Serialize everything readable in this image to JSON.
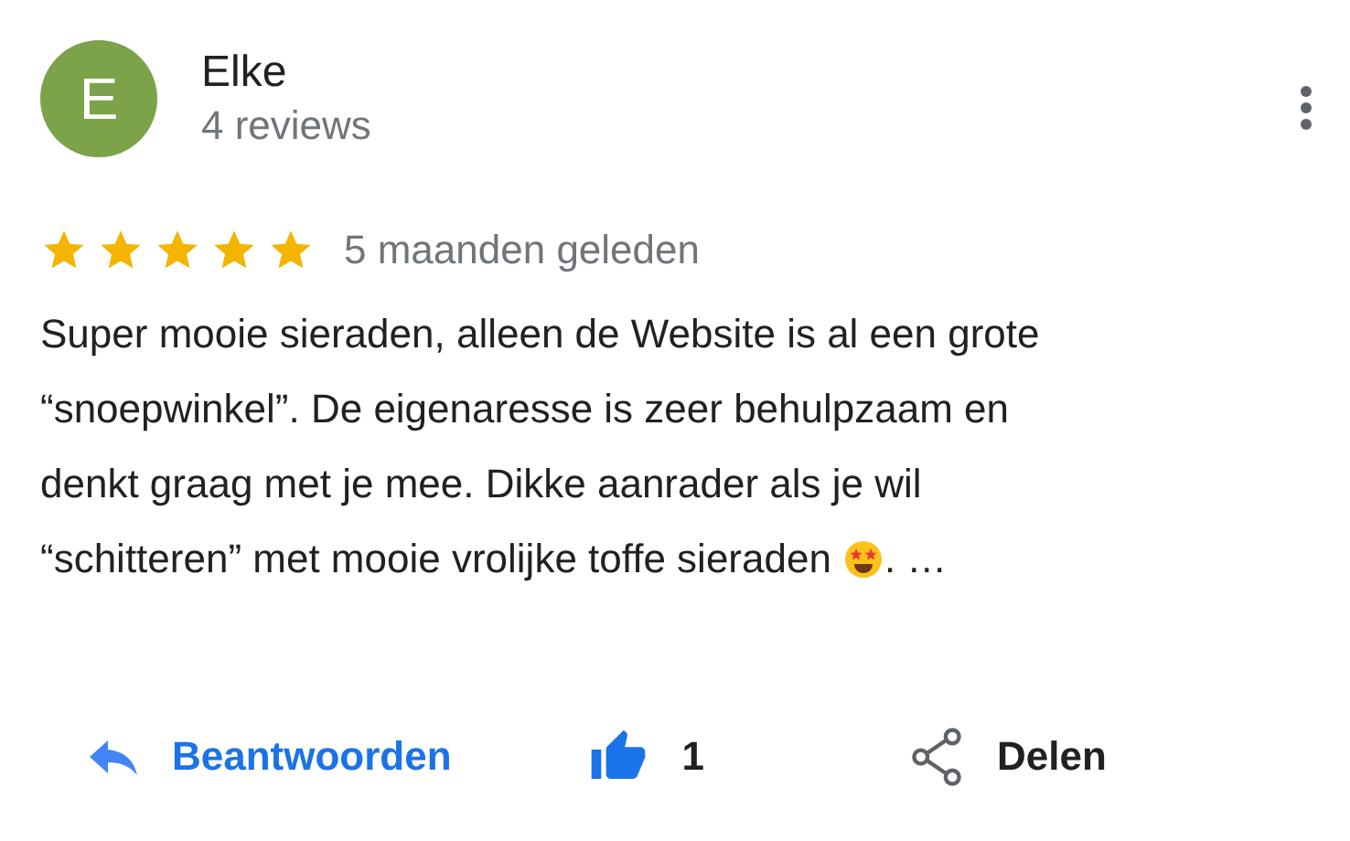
{
  "reviewer": {
    "initial": "E",
    "name": "Elke",
    "reviews": "4 reviews"
  },
  "rating": {
    "stars": 5,
    "age": "5 maanden geleden"
  },
  "review": {
    "lines": [
      "Super mooie sieraden, alleen de Website is al een grote",
      "“snoepwinkel”. De eigenaresse is zeer behulpzaam en",
      "denkt graag met je mee. Dikke aanrader als je wil",
      "“schitteren” met mooie vrolijke toffe sieraden"
    ],
    "tail": ". …"
  },
  "actions": {
    "reply": "Beantwoorden",
    "likes": "1",
    "liked": true,
    "share": "Delen"
  }
}
